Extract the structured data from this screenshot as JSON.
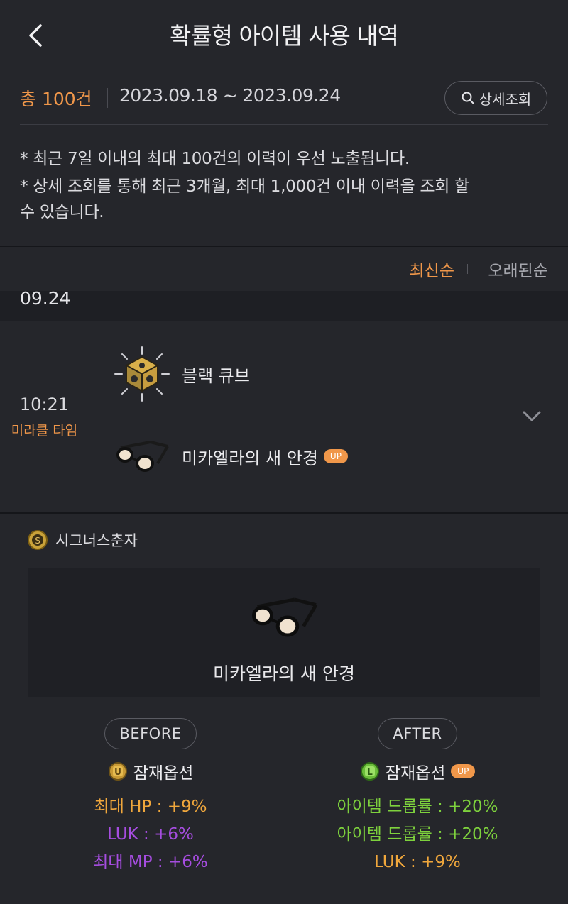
{
  "header": {
    "title": "확률형 아이템 사용 내역",
    "back_icon": "chevron-left-icon"
  },
  "summary": {
    "total": "총 100건",
    "date_range": "2023.09.18 ~ 2023.09.24",
    "detail_button": "상세조회",
    "notices": [
      "* 최근 7일 이내의 최대 100건의 이력이 우선 노출됩니다.",
      "* 상세 조회를 통해 최근 3개월, 최대 1,000건 이내 이력을 조회 할",
      "수 있습니다."
    ]
  },
  "sort": {
    "latest": "최신순",
    "oldest": "오래된순",
    "active": "최신순"
  },
  "group_date": "09.24",
  "record": {
    "time": "10:21",
    "event": "미라클 타임",
    "items": [
      {
        "name": "블랙 큐브",
        "icon": "black-cube-icon",
        "badge": ""
      },
      {
        "name": "미카엘라의 새 안경",
        "icon": "glasses-icon",
        "badge": "UP"
      }
    ]
  },
  "detail": {
    "character": "시그너스춘자",
    "item_name": "미카엘라의 새 안경",
    "before": {
      "label": "BEFORE",
      "grade_letter": "U",
      "potential_label": "잠재옵션",
      "badge": "",
      "options": [
        {
          "text": "최대 HP : +9%",
          "color": "#f0a73c"
        },
        {
          "text": "LUK : +6%",
          "color": "#a64de0"
        },
        {
          "text": "최대 MP : +6%",
          "color": "#a64de0"
        }
      ]
    },
    "after": {
      "label": "AFTER",
      "grade_letter": "L",
      "potential_label": "잠재옵션",
      "badge": "UP",
      "options": [
        {
          "text": "아이템 드롭률 : +20%",
          "color": "#7ed23d"
        },
        {
          "text": "아이템 드롭률 : +20%",
          "color": "#7ed23d"
        },
        {
          "text": "LUK : +9%",
          "color": "#f0a73c"
        }
      ]
    }
  },
  "colors": {
    "accent": "#f0974a",
    "unique": "#f0a73c",
    "epic": "#a64de0",
    "legendary": "#7ed23d"
  }
}
